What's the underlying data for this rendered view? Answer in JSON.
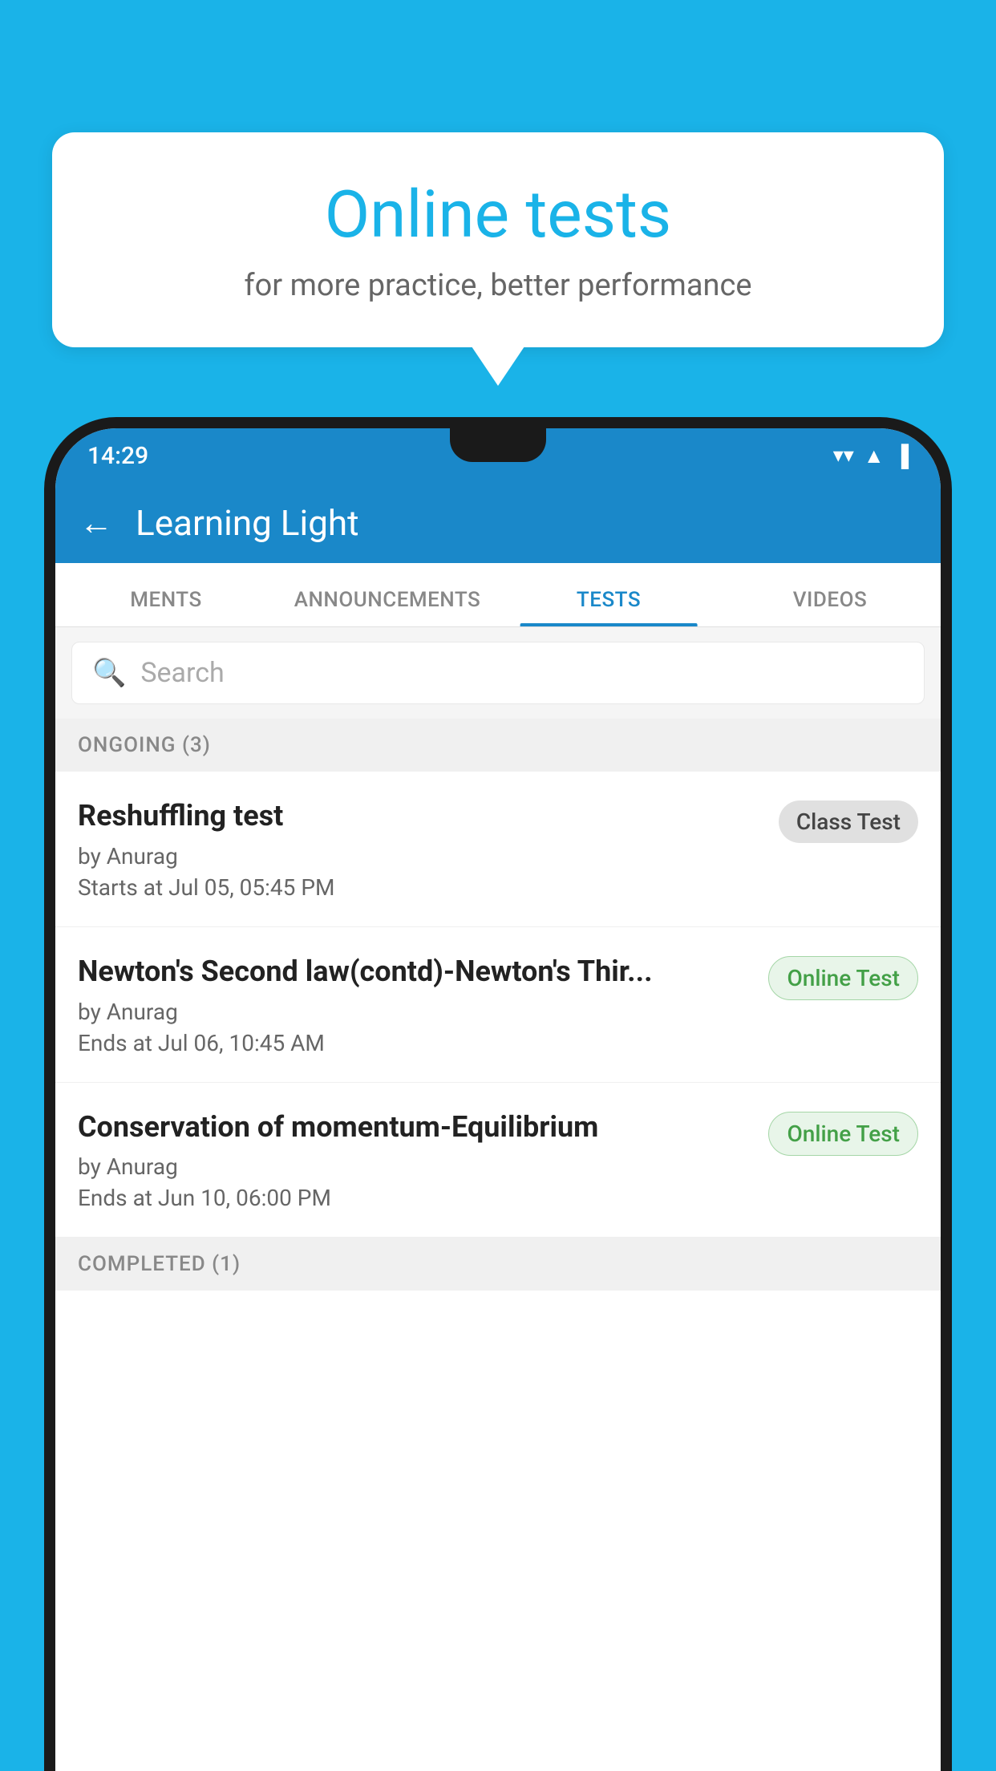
{
  "background_color": "#1ab3e8",
  "speech_bubble": {
    "title": "Online tests",
    "subtitle": "for more practice, better performance"
  },
  "status_bar": {
    "time": "14:29",
    "wifi_icon": "▼",
    "signal_icon": "▲",
    "battery_icon": "▐"
  },
  "app_header": {
    "title": "Learning Light",
    "back_label": "←"
  },
  "tabs": [
    {
      "label": "MENTS",
      "active": false
    },
    {
      "label": "ANNOUNCEMENTS",
      "active": false
    },
    {
      "label": "TESTS",
      "active": true
    },
    {
      "label": "VIDEOS",
      "active": false
    }
  ],
  "search": {
    "placeholder": "Search"
  },
  "sections": [
    {
      "header": "ONGOING (3)",
      "tests": [
        {
          "name": "Reshuffling test",
          "by": "by Anurag",
          "date": "Starts at  Jul 05, 05:45 PM",
          "badge": "Class Test",
          "badge_type": "class"
        },
        {
          "name": "Newton's Second law(contd)-Newton's Thir...",
          "by": "by Anurag",
          "date": "Ends at  Jul 06, 10:45 AM",
          "badge": "Online Test",
          "badge_type": "online"
        },
        {
          "name": "Conservation of momentum-Equilibrium",
          "by": "by Anurag",
          "date": "Ends at  Jun 10, 06:00 PM",
          "badge": "Online Test",
          "badge_type": "online"
        }
      ]
    }
  ],
  "completed_section": {
    "header": "COMPLETED (1)"
  }
}
